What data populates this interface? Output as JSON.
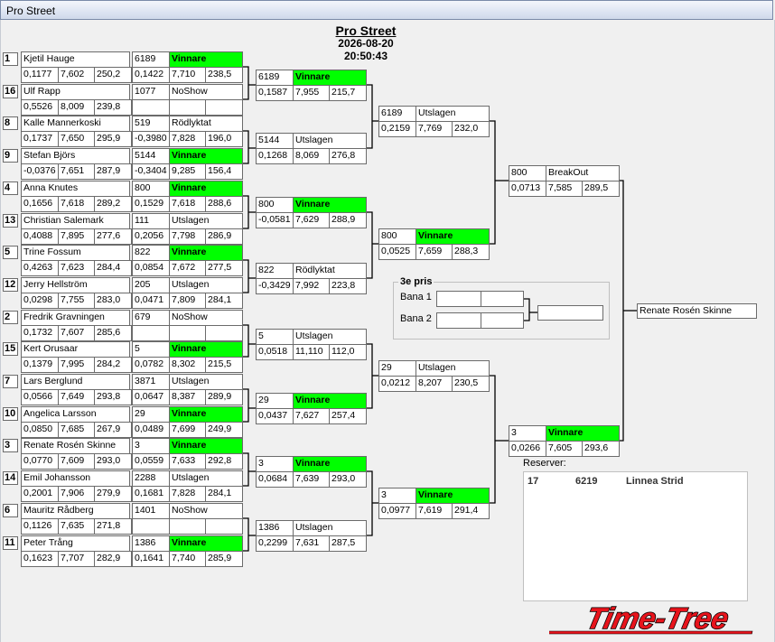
{
  "window": {
    "title": "Pro Street"
  },
  "event": {
    "name": "Pro Street",
    "datetime": "2026-08-20 20:50:43"
  },
  "colors": {
    "winner_highlight": "#00ff00",
    "logo_red": "#e8141c"
  },
  "round1": [
    {
      "seed": "1",
      "name": "Kjetil Hauge",
      "rt": "0,1177",
      "et": "7,602",
      "speed": "250,2"
    },
    {
      "seed": "16",
      "name": "Ulf Rapp",
      "rt": "0,5526",
      "et": "8,009",
      "speed": "239,8"
    },
    {
      "seed": "8",
      "name": "Kalle Mannerkoski",
      "rt": "0,1737",
      "et": "7,650",
      "speed": "295,9"
    },
    {
      "seed": "9",
      "name": "Stefan Björs",
      "rt": "-0,0376",
      "et": "7,651",
      "speed": "287,9"
    },
    {
      "seed": "4",
      "name": "Anna Knutes",
      "rt": "0,1656",
      "et": "7,618",
      "speed": "289,2"
    },
    {
      "seed": "13",
      "name": "Christian Salemark",
      "rt": "0,4088",
      "et": "7,895",
      "speed": "277,6"
    },
    {
      "seed": "5",
      "name": "Trine Fossum",
      "rt": "0,4263",
      "et": "7,623",
      "speed": "284,4"
    },
    {
      "seed": "12",
      "name": "Jerry Hellström",
      "rt": "0,0298",
      "et": "7,755",
      "speed": "283,0"
    },
    {
      "seed": "2",
      "name": "Fredrik Gravningen",
      "rt": "0,1732",
      "et": "7,607",
      "speed": "285,6"
    },
    {
      "seed": "15",
      "name": "Kert Orusaar",
      "rt": "0,1379",
      "et": "7,995",
      "speed": "284,2"
    },
    {
      "seed": "7",
      "name": "Lars Berglund",
      "rt": "0,0566",
      "et": "7,649",
      "speed": "293,8"
    },
    {
      "seed": "10",
      "name": "Angelica Larsson",
      "rt": "0,0850",
      "et": "7,685",
      "speed": "267,9"
    },
    {
      "seed": "3",
      "name": "Renate Rosén Skinne",
      "rt": "0,0770",
      "et": "7,609",
      "speed": "293,0"
    },
    {
      "seed": "14",
      "name": "Emil Johansson",
      "rt": "0,2001",
      "et": "7,906",
      "speed": "279,9"
    },
    {
      "seed": "6",
      "name": "Mauritz Rådberg",
      "rt": "0,1126",
      "et": "7,635",
      "speed": "271,8"
    },
    {
      "seed": "11",
      "name": "Peter Trång",
      "rt": "0,1623",
      "et": "7,707",
      "speed": "282,9"
    }
  ],
  "round2": [
    {
      "id": "6189",
      "status": "Vinnare",
      "win": true,
      "rt": "0,1422",
      "et": "7,710",
      "speed": "238,5"
    },
    {
      "id": "1077",
      "status": "NoShow",
      "win": false,
      "rt": "",
      "et": "",
      "speed": ""
    },
    {
      "id": "519",
      "status": "Rödlyktat",
      "win": false,
      "rt": "-0,3980",
      "et": "7,828",
      "speed": "196,0"
    },
    {
      "id": "5144",
      "status": "Vinnare",
      "win": true,
      "rt": "-0,3404",
      "et": "9,285",
      "speed": "156,4"
    },
    {
      "id": "800",
      "status": "Vinnare",
      "win": true,
      "rt": "0,1529",
      "et": "7,618",
      "speed": "288,6"
    },
    {
      "id": "111",
      "status": "Utslagen",
      "win": false,
      "rt": "0,2056",
      "et": "7,798",
      "speed": "286,9"
    },
    {
      "id": "822",
      "status": "Vinnare",
      "win": true,
      "rt": "0,0854",
      "et": "7,672",
      "speed": "277,5"
    },
    {
      "id": "205",
      "status": "Utslagen",
      "win": false,
      "rt": "0,0471",
      "et": "7,809",
      "speed": "284,1"
    },
    {
      "id": "679",
      "status": "NoShow",
      "win": false,
      "rt": "",
      "et": "",
      "speed": ""
    },
    {
      "id": "5",
      "status": "Vinnare",
      "win": true,
      "rt": "0,0782",
      "et": "8,302",
      "speed": "215,5"
    },
    {
      "id": "3871",
      "status": "Utslagen",
      "win": false,
      "rt": "0,0647",
      "et": "8,387",
      "speed": "289,9"
    },
    {
      "id": "29",
      "status": "Vinnare",
      "win": true,
      "rt": "0,0489",
      "et": "7,699",
      "speed": "249,9"
    },
    {
      "id": "3",
      "status": "Vinnare",
      "win": true,
      "rt": "0,0559",
      "et": "7,633",
      "speed": "292,8"
    },
    {
      "id": "2288",
      "status": "Utslagen",
      "win": false,
      "rt": "0,1681",
      "et": "7,828",
      "speed": "284,1"
    },
    {
      "id": "1401",
      "status": "NoShow",
      "win": false,
      "rt": "",
      "et": "",
      "speed": ""
    },
    {
      "id": "1386",
      "status": "Vinnare",
      "win": true,
      "rt": "0,1641",
      "et": "7,740",
      "speed": "285,9"
    }
  ],
  "round3": [
    {
      "id": "6189",
      "status": "Vinnare",
      "win": true,
      "rt": "0,1587",
      "et": "7,955",
      "speed": "215,7"
    },
    {
      "id": "5144",
      "status": "Utslagen",
      "win": false,
      "rt": "0,1268",
      "et": "8,069",
      "speed": "276,8"
    },
    {
      "id": "800",
      "status": "Vinnare",
      "win": true,
      "rt": "-0,0581",
      "et": "7,629",
      "speed": "288,9"
    },
    {
      "id": "822",
      "status": "Rödlyktat",
      "win": false,
      "rt": "-0,3429",
      "et": "7,992",
      "speed": "223,8"
    },
    {
      "id": "5",
      "status": "Utslagen",
      "win": false,
      "rt": "0,0518",
      "et": "11,110",
      "speed": "112,0"
    },
    {
      "id": "29",
      "status": "Vinnare",
      "win": true,
      "rt": "0,0437",
      "et": "7,627",
      "speed": "257,4"
    },
    {
      "id": "3",
      "status": "Vinnare",
      "win": true,
      "rt": "0,0684",
      "et": "7,639",
      "speed": "293,0"
    },
    {
      "id": "1386",
      "status": "Utslagen",
      "win": false,
      "rt": "0,2299",
      "et": "7,631",
      "speed": "287,5"
    }
  ],
  "round4": [
    {
      "id": "6189",
      "status": "Utslagen",
      "win": false,
      "rt": "0,2159",
      "et": "7,769",
      "speed": "232,0"
    },
    {
      "id": "800",
      "status": "Vinnare",
      "win": true,
      "rt": "0,0525",
      "et": "7,659",
      "speed": "288,3"
    },
    {
      "id": "29",
      "status": "Utslagen",
      "win": false,
      "rt": "0,0212",
      "et": "8,207",
      "speed": "230,5"
    },
    {
      "id": "3",
      "status": "Vinnare",
      "win": true,
      "rt": "0,0977",
      "et": "7,619",
      "speed": "291,4"
    }
  ],
  "round5": [
    {
      "id": "800",
      "status": "BreakOut",
      "win": false,
      "rt": "0,0713",
      "et": "7,585",
      "speed": "289,5"
    },
    {
      "id": "3",
      "status": "Vinnare",
      "win": true,
      "rt": "0,0266",
      "et": "7,605",
      "speed": "293,6"
    }
  ],
  "champion": {
    "name": "Renate Rosén Skinne"
  },
  "third_place": {
    "legend": "3e pris",
    "lane1": "Bana 1",
    "lane2": "Bana 2"
  },
  "reserves": {
    "label": "Reserver:",
    "items": [
      {
        "num": "17",
        "id": "6219",
        "name": "Linnea Strid"
      }
    ]
  },
  "logo": {
    "text": "Time-Tree"
  }
}
